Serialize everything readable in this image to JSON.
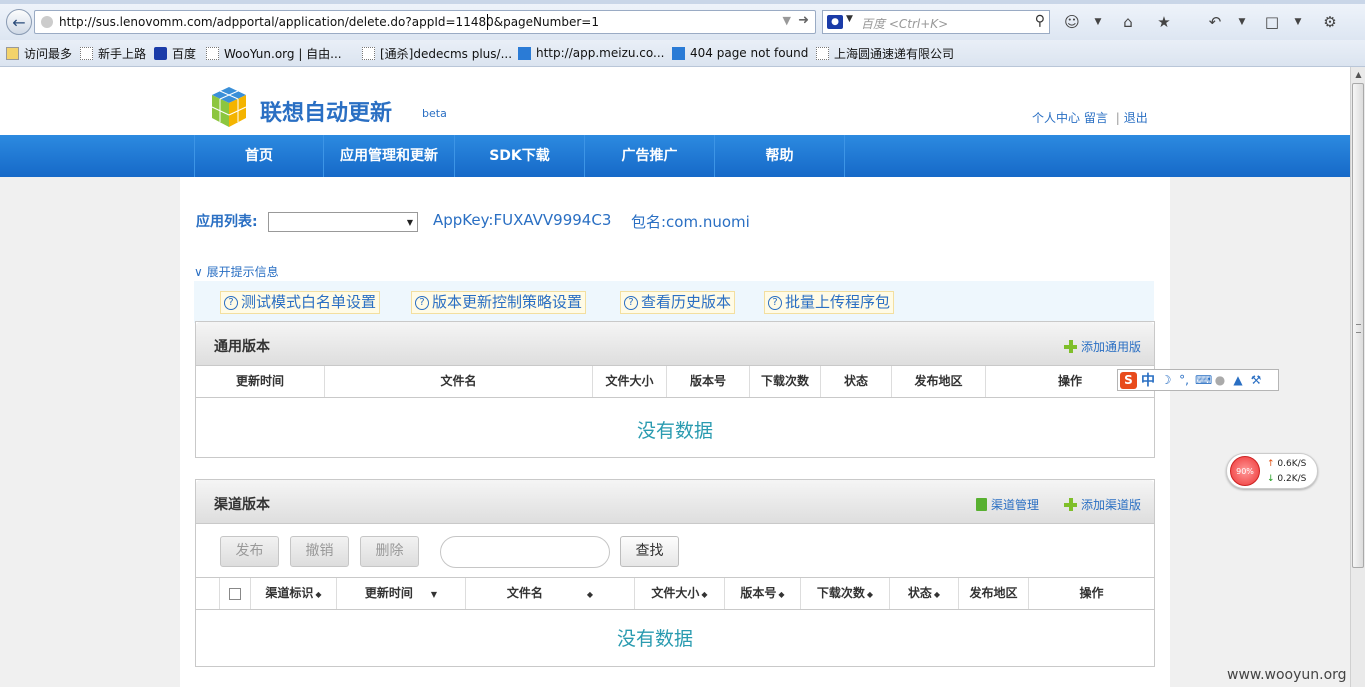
{
  "browser": {
    "url": "http://sus.lenovomm.com/adpportal/application/delete.do?appId=11480&pageNumber=1",
    "search_placeholder": "百度 <Ctrl+K>",
    "bookmarks": [
      "访问最多",
      "新手上路",
      "百度",
      "WooYun.org | 自由...",
      "[通杀]dedecms plus/...",
      "http://app.meizu.co...",
      "404 page not found",
      "上海圆通速递有限公司"
    ]
  },
  "site": {
    "logo_text": "联想自动更新",
    "beta": "beta",
    "header_links": {
      "center": "个人中心",
      "message": "留言",
      "logout": "退出",
      "sep": "|"
    },
    "nav": [
      "首页",
      "应用管理和更新",
      "SDK下载",
      "广告推广",
      "帮助"
    ]
  },
  "app_bar": {
    "label": "应用列表:",
    "appkey": "AppKey:FUXAVV9994C3",
    "package": "包名:com.nuomi"
  },
  "hints": {
    "toggle": "展开提示信息",
    "links": [
      "测试模式白名单设置",
      "版本更新控制策略设置",
      "查看历史版本",
      "批量上传程序包"
    ]
  },
  "general_panel": {
    "title": "通用版本",
    "add": "添加通用版",
    "columns": [
      "更新时间",
      "文件名",
      "文件大小",
      "版本号",
      "下载次数",
      "状态",
      "发布地区",
      "操作"
    ],
    "empty": "没有数据"
  },
  "channel_panel": {
    "title": "渠道版本",
    "manage": "渠道管理",
    "add": "添加渠道版",
    "buttons": {
      "publish": "发布",
      "revoke": "撤销",
      "delete": "删除",
      "find": "查找"
    },
    "columns": [
      "渠道标识",
      "更新时间",
      "文件名",
      "文件大小",
      "版本号",
      "下载次数",
      "状态",
      "发布地区",
      "操作"
    ],
    "empty": "没有数据"
  },
  "ime": {
    "zh": "中"
  },
  "net": {
    "percent": "90%",
    "up": "0.6K/S",
    "down": "0.2K/S"
  },
  "watermark": "www.wooyun.org"
}
